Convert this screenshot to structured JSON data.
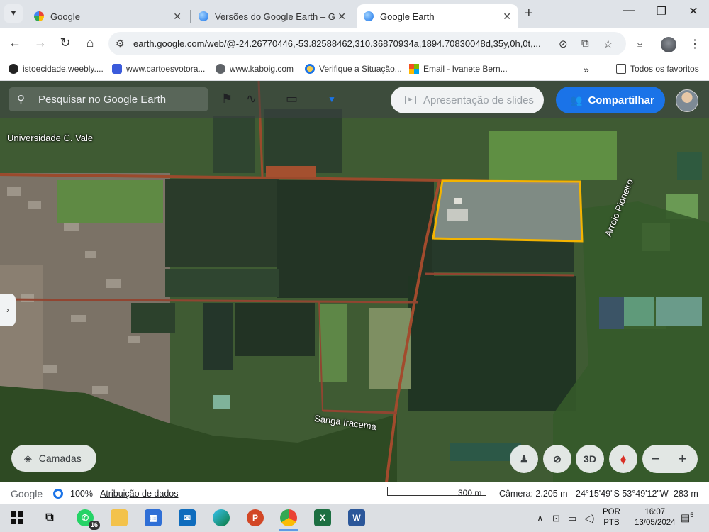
{
  "browser": {
    "tabs": [
      {
        "title": "Google",
        "favicon": "google-icon",
        "active": false
      },
      {
        "title": "Versões do Google Earth – Goo",
        "favicon": "earth-icon",
        "active": false
      },
      {
        "title": "Google Earth",
        "favicon": "earth-icon",
        "active": true
      }
    ],
    "url": "earth.google.com/web/@-24.26770446,-53.82588462,310.36870934a,1894.70830048d,35y,0h,0t,...",
    "bookmarks": [
      {
        "label": "istoecidade.weebly....",
        "icon": "weebly-icon"
      },
      {
        "label": "www.cartoesvotora...",
        "icon": "cartoes-icon"
      },
      {
        "label": "www.kaboig.com",
        "icon": "globe-icon"
      },
      {
        "label": "Verifique a Situação...",
        "icon": "circle-icon"
      },
      {
        "label": "Email - Ivanete Bern...",
        "icon": "microsoft-icon"
      }
    ],
    "bookmarks_more": "»",
    "all_bookmarks": "Todos os favoritos"
  },
  "earth": {
    "search_placeholder": "Pesquisar no Google Earth",
    "slides_button": "Apresentação de slides",
    "share_button": "Compartilhar",
    "layers_button": "Camadas",
    "map_labels": {
      "university": "Universidade C. Vale",
      "stream1": "Arroio Pioneiro",
      "stream2": "Sanga Iracema"
    },
    "controls": {
      "three_d": "3D",
      "zoom_out": "−",
      "zoom_in": "+"
    },
    "status": {
      "google": "Google",
      "zoom": "100%",
      "attribution": "Atribuição de dados",
      "scale": "300 m",
      "camera": "Câmera: 2.205 m",
      "coords": "24°15'49\"S 53°49'12\"W",
      "altitude": "283 m"
    }
  },
  "taskbar": {
    "whatsapp_badge": "16",
    "lang_top": "POR",
    "lang_bottom": "PTB",
    "time": "16:07",
    "date": "13/05/2024",
    "notifications": "5"
  },
  "colors": {
    "share_blue": "#1a73e8",
    "highlight_outline": "#f4b400"
  }
}
